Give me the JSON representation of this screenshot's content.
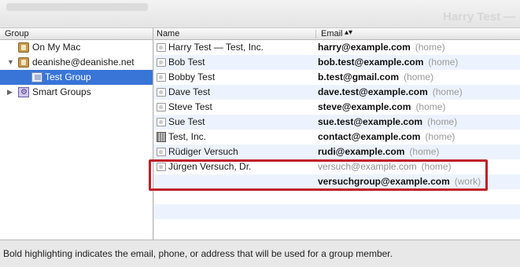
{
  "window": {
    "title_ghost": "Harry Test —"
  },
  "groups": {
    "header": "Group",
    "items": [
      {
        "label": "On My Mac",
        "icon": "address-book-icon",
        "expanded": null
      },
      {
        "label": "deanishe@deanishe.net",
        "icon": "address-book-icon",
        "expanded": true
      },
      {
        "label": "Test Group",
        "icon": "group-icon",
        "selected": true
      },
      {
        "label": "Smart Groups",
        "icon": "smart-group-icon",
        "expanded": false
      }
    ]
  },
  "members": {
    "header_name": "Name",
    "header_email": "Email",
    "sort_indicator": "▴▾",
    "rows": [
      {
        "name": "Harry Test — Test, Inc.",
        "icon": "person-card-icon",
        "emails": [
          {
            "address": "harry@example.com",
            "label": "(home)",
            "bold": true
          }
        ]
      },
      {
        "name": "Bob Test",
        "icon": "person-card-icon",
        "emails": [
          {
            "address": "bob.test@example.com",
            "label": "(home)",
            "bold": true
          }
        ]
      },
      {
        "name": "Bobby Test",
        "icon": "person-card-icon",
        "emails": [
          {
            "address": "b.test@gmail.com",
            "label": "(home)",
            "bold": true
          }
        ]
      },
      {
        "name": "Dave Test",
        "icon": "person-card-icon",
        "emails": [
          {
            "address": "dave.test@example.com",
            "label": "(home)",
            "bold": true
          }
        ]
      },
      {
        "name": "Steve Test",
        "icon": "person-card-icon",
        "emails": [
          {
            "address": "steve@example.com",
            "label": "(home)",
            "bold": true
          }
        ]
      },
      {
        "name": "Sue Test",
        "icon": "person-card-icon",
        "emails": [
          {
            "address": "sue.test@example.com",
            "label": "(home)",
            "bold": true
          }
        ]
      },
      {
        "name": "Test, Inc.",
        "icon": "company-icon",
        "emails": [
          {
            "address": "contact@example.com",
            "label": "(home)",
            "bold": true
          }
        ]
      },
      {
        "name": "Rüdiger Versuch",
        "icon": "person-card-icon",
        "emails": [
          {
            "address": "rudi@example.com",
            "label": "(home)",
            "bold": true
          }
        ]
      },
      {
        "name": "Jürgen Versuch, Dr.",
        "icon": "person-card-icon",
        "emails": [
          {
            "address": "versuch@example.com",
            "label": "(home)",
            "bold": false
          },
          {
            "address": "versuchgroup@example.com",
            "label": "(work)",
            "bold": true
          }
        ]
      }
    ]
  },
  "footer": {
    "note": "Bold highlighting indicates the email, phone, or address that will be used for a group member."
  },
  "colors": {
    "selection": "#3875d7",
    "alt_row": "#edf3fe",
    "highlight_box": "#c0202a"
  }
}
